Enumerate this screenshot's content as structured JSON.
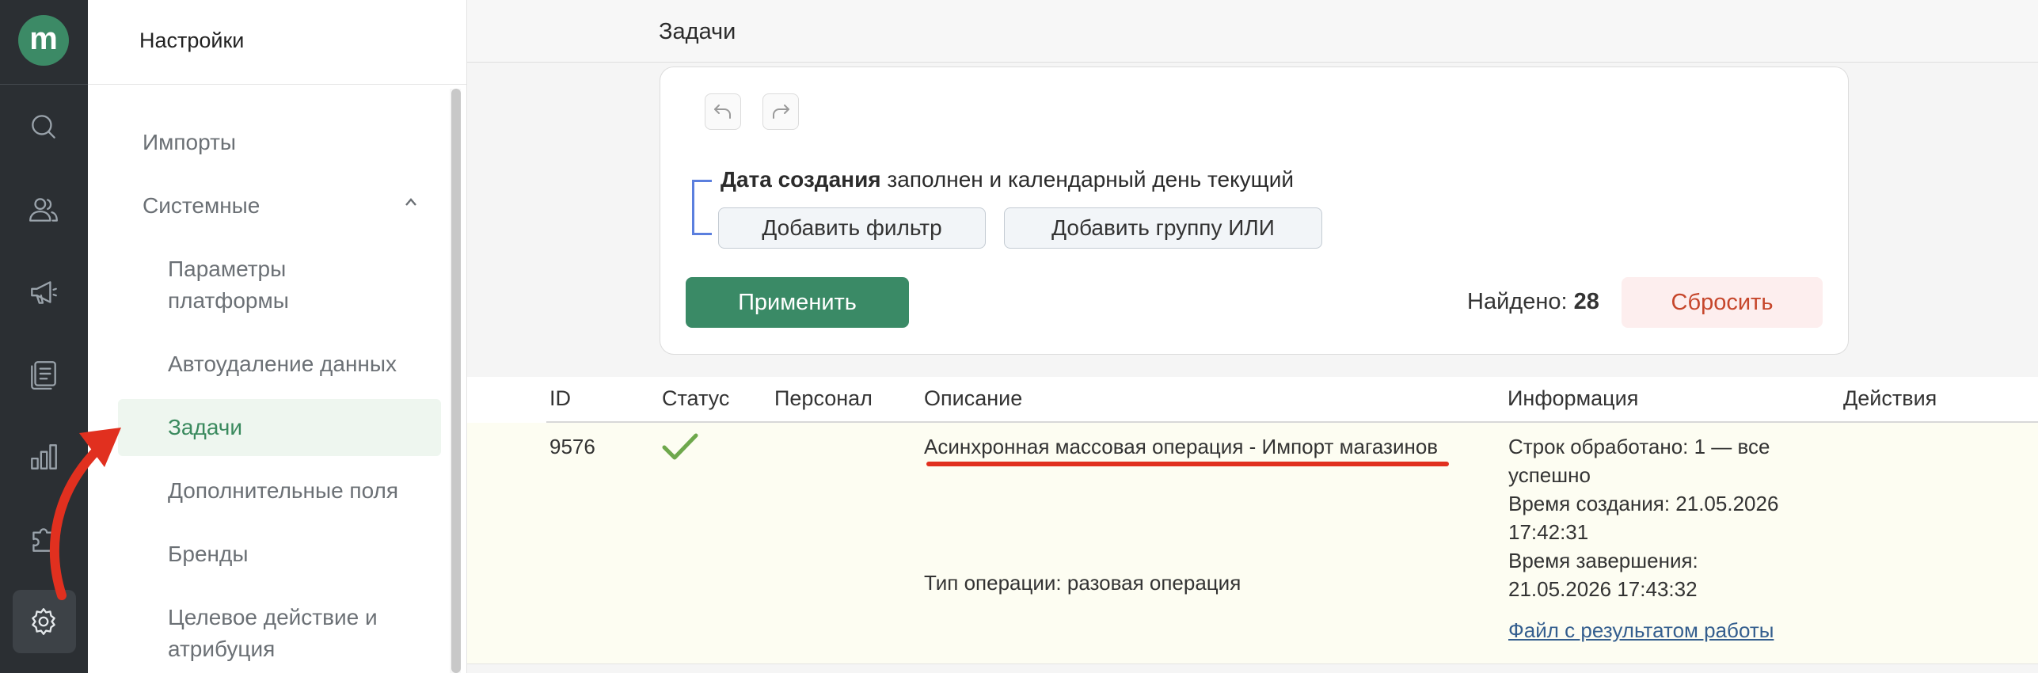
{
  "app": {
    "logo_letter": "m"
  },
  "rail": {
    "icons": [
      "search-icon",
      "users-icon",
      "megaphone-icon",
      "documents-icon",
      "bar-chart-icon",
      "puzzle-icon",
      "gear-icon"
    ],
    "active": "gear-icon"
  },
  "settings_panel": {
    "title": "Настройки",
    "items": {
      "imports": "Импорты",
      "system": "Системные",
      "platform_params_1": "Параметры",
      "platform_params_2": "платформы",
      "auto_delete": "Автоудаление данных",
      "tasks": "Задачи",
      "extra_fields": "Дополнительные поля",
      "brands": "Бренды",
      "target_action_1": "Целевое действие и",
      "target_action_2": "атрибуция"
    },
    "active_item": "Задачи"
  },
  "main": {
    "title": "Задачи",
    "filter": {
      "condition_field": "Дата создания",
      "condition_text": " заполнен и календарный день текущий",
      "add_filter": "Добавить фильтр",
      "add_or_group": "Добавить группу ИЛИ",
      "apply": "Применить",
      "found_label": "Найдено: ",
      "found_count": "28",
      "reset": "Сбросить"
    },
    "table": {
      "columns": [
        "ID",
        "Статус",
        "Персонал",
        "Описание",
        "Информация",
        "Действия"
      ],
      "rows": [
        {
          "id": "9576",
          "status": "success",
          "staff": "",
          "description": "Асинхронная массовая операция - Импорт магазинов",
          "operation_type": "Тип операции: разовая операция",
          "info_lines": [
            "Строк обработано: 1 — все",
            "успешно",
            "Время создания: 21.05.2026",
            "17:42:31",
            "Время завершения:",
            "21.05.2026 17:43:32"
          ],
          "result_link": "Файл с результатом работы"
        }
      ]
    }
  },
  "colors": {
    "rail_bg": "#2b2f33",
    "brand_green": "#3a8a66",
    "active_nav_bg": "#eef6ef",
    "reset_text": "#c6462b",
    "annotation_red": "#e1301f",
    "link": "#345e8e"
  }
}
